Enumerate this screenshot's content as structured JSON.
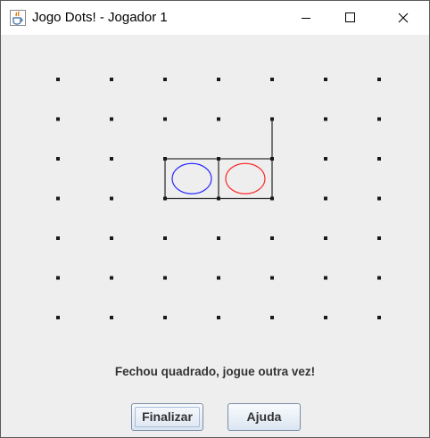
{
  "window": {
    "title": "Jogo Dots! - Jogador 1",
    "app_icon": "java-cup-icon"
  },
  "titlebar_controls": [
    "minimize-icon",
    "maximize-icon",
    "close-icon"
  ],
  "game": {
    "grid": {
      "rows": 7,
      "cols": 7,
      "dot_color": "#1a1a1a",
      "line_color": "#333333"
    },
    "lines": [
      {
        "from": [
          2,
          2
        ],
        "to": [
          2,
          4
        ]
      },
      {
        "from": [
          3,
          2
        ],
        "to": [
          3,
          4
        ]
      },
      {
        "from": [
          2,
          2
        ],
        "to": [
          3,
          2
        ]
      },
      {
        "from": [
          2,
          3
        ],
        "to": [
          3,
          3
        ]
      },
      {
        "from": [
          2,
          4
        ],
        "to": [
          3,
          4
        ]
      },
      {
        "from": [
          1,
          4
        ],
        "to": [
          2,
          4
        ]
      }
    ],
    "boxes": [
      {
        "row": 2,
        "col": 2,
        "owner": "Jogador 1",
        "color": "#2828ff"
      },
      {
        "row": 2,
        "col": 3,
        "owner": "Jogador 2",
        "color": "#ff2828"
      }
    ]
  },
  "status": {
    "message": "Fechou quadrado, jogue outra vez!"
  },
  "buttons": {
    "finalizar": "Finalizar",
    "ajuda": "Ajuda"
  }
}
